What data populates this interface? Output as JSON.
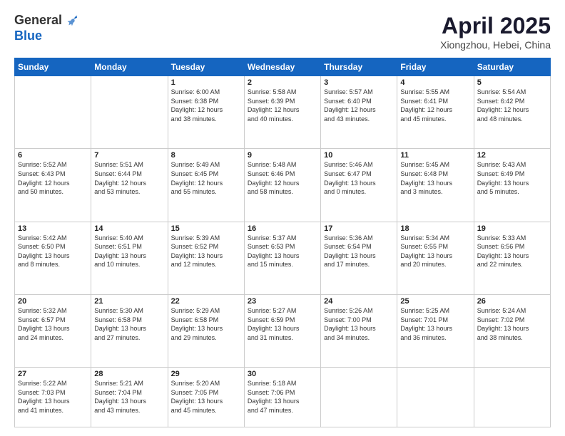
{
  "header": {
    "logo_line1": "General",
    "logo_line2": "Blue",
    "month": "April 2025",
    "location": "Xiongzhou, Hebei, China"
  },
  "weekdays": [
    "Sunday",
    "Monday",
    "Tuesday",
    "Wednesday",
    "Thursday",
    "Friday",
    "Saturday"
  ],
  "weeks": [
    [
      {
        "num": "",
        "info": ""
      },
      {
        "num": "",
        "info": ""
      },
      {
        "num": "1",
        "info": "Sunrise: 6:00 AM\nSunset: 6:38 PM\nDaylight: 12 hours\nand 38 minutes."
      },
      {
        "num": "2",
        "info": "Sunrise: 5:58 AM\nSunset: 6:39 PM\nDaylight: 12 hours\nand 40 minutes."
      },
      {
        "num": "3",
        "info": "Sunrise: 5:57 AM\nSunset: 6:40 PM\nDaylight: 12 hours\nand 43 minutes."
      },
      {
        "num": "4",
        "info": "Sunrise: 5:55 AM\nSunset: 6:41 PM\nDaylight: 12 hours\nand 45 minutes."
      },
      {
        "num": "5",
        "info": "Sunrise: 5:54 AM\nSunset: 6:42 PM\nDaylight: 12 hours\nand 48 minutes."
      }
    ],
    [
      {
        "num": "6",
        "info": "Sunrise: 5:52 AM\nSunset: 6:43 PM\nDaylight: 12 hours\nand 50 minutes."
      },
      {
        "num": "7",
        "info": "Sunrise: 5:51 AM\nSunset: 6:44 PM\nDaylight: 12 hours\nand 53 minutes."
      },
      {
        "num": "8",
        "info": "Sunrise: 5:49 AM\nSunset: 6:45 PM\nDaylight: 12 hours\nand 55 minutes."
      },
      {
        "num": "9",
        "info": "Sunrise: 5:48 AM\nSunset: 6:46 PM\nDaylight: 12 hours\nand 58 minutes."
      },
      {
        "num": "10",
        "info": "Sunrise: 5:46 AM\nSunset: 6:47 PM\nDaylight: 13 hours\nand 0 minutes."
      },
      {
        "num": "11",
        "info": "Sunrise: 5:45 AM\nSunset: 6:48 PM\nDaylight: 13 hours\nand 3 minutes."
      },
      {
        "num": "12",
        "info": "Sunrise: 5:43 AM\nSunset: 6:49 PM\nDaylight: 13 hours\nand 5 minutes."
      }
    ],
    [
      {
        "num": "13",
        "info": "Sunrise: 5:42 AM\nSunset: 6:50 PM\nDaylight: 13 hours\nand 8 minutes."
      },
      {
        "num": "14",
        "info": "Sunrise: 5:40 AM\nSunset: 6:51 PM\nDaylight: 13 hours\nand 10 minutes."
      },
      {
        "num": "15",
        "info": "Sunrise: 5:39 AM\nSunset: 6:52 PM\nDaylight: 13 hours\nand 12 minutes."
      },
      {
        "num": "16",
        "info": "Sunrise: 5:37 AM\nSunset: 6:53 PM\nDaylight: 13 hours\nand 15 minutes."
      },
      {
        "num": "17",
        "info": "Sunrise: 5:36 AM\nSunset: 6:54 PM\nDaylight: 13 hours\nand 17 minutes."
      },
      {
        "num": "18",
        "info": "Sunrise: 5:34 AM\nSunset: 6:55 PM\nDaylight: 13 hours\nand 20 minutes."
      },
      {
        "num": "19",
        "info": "Sunrise: 5:33 AM\nSunset: 6:56 PM\nDaylight: 13 hours\nand 22 minutes."
      }
    ],
    [
      {
        "num": "20",
        "info": "Sunrise: 5:32 AM\nSunset: 6:57 PM\nDaylight: 13 hours\nand 24 minutes."
      },
      {
        "num": "21",
        "info": "Sunrise: 5:30 AM\nSunset: 6:58 PM\nDaylight: 13 hours\nand 27 minutes."
      },
      {
        "num": "22",
        "info": "Sunrise: 5:29 AM\nSunset: 6:58 PM\nDaylight: 13 hours\nand 29 minutes."
      },
      {
        "num": "23",
        "info": "Sunrise: 5:27 AM\nSunset: 6:59 PM\nDaylight: 13 hours\nand 31 minutes."
      },
      {
        "num": "24",
        "info": "Sunrise: 5:26 AM\nSunset: 7:00 PM\nDaylight: 13 hours\nand 34 minutes."
      },
      {
        "num": "25",
        "info": "Sunrise: 5:25 AM\nSunset: 7:01 PM\nDaylight: 13 hours\nand 36 minutes."
      },
      {
        "num": "26",
        "info": "Sunrise: 5:24 AM\nSunset: 7:02 PM\nDaylight: 13 hours\nand 38 minutes."
      }
    ],
    [
      {
        "num": "27",
        "info": "Sunrise: 5:22 AM\nSunset: 7:03 PM\nDaylight: 13 hours\nand 41 minutes."
      },
      {
        "num": "28",
        "info": "Sunrise: 5:21 AM\nSunset: 7:04 PM\nDaylight: 13 hours\nand 43 minutes."
      },
      {
        "num": "29",
        "info": "Sunrise: 5:20 AM\nSunset: 7:05 PM\nDaylight: 13 hours\nand 45 minutes."
      },
      {
        "num": "30",
        "info": "Sunrise: 5:18 AM\nSunset: 7:06 PM\nDaylight: 13 hours\nand 47 minutes."
      },
      {
        "num": "",
        "info": ""
      },
      {
        "num": "",
        "info": ""
      },
      {
        "num": "",
        "info": ""
      }
    ]
  ]
}
